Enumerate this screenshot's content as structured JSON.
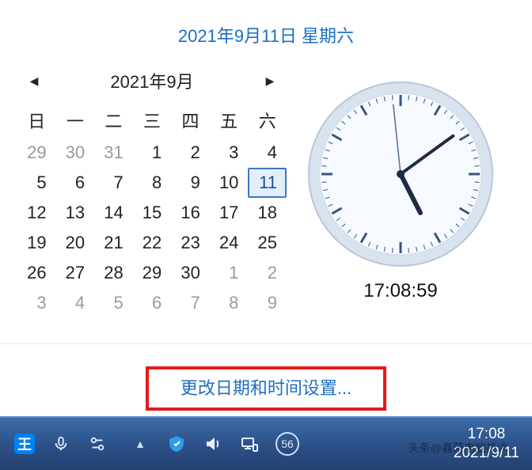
{
  "header": {
    "date_title": "2021年9月11日 星期六"
  },
  "calendar": {
    "month_label": "2021年9月",
    "weekdays": [
      "日",
      "一",
      "二",
      "三",
      "四",
      "五",
      "六"
    ],
    "days": [
      {
        "n": "29",
        "muted": true
      },
      {
        "n": "30",
        "muted": true
      },
      {
        "n": "31",
        "muted": true
      },
      {
        "n": "1"
      },
      {
        "n": "2"
      },
      {
        "n": "3"
      },
      {
        "n": "4"
      },
      {
        "n": "5"
      },
      {
        "n": "6"
      },
      {
        "n": "7"
      },
      {
        "n": "8"
      },
      {
        "n": "9"
      },
      {
        "n": "10"
      },
      {
        "n": "11",
        "today": true
      },
      {
        "n": "12"
      },
      {
        "n": "13"
      },
      {
        "n": "14"
      },
      {
        "n": "15"
      },
      {
        "n": "16"
      },
      {
        "n": "17"
      },
      {
        "n": "18"
      },
      {
        "n": "19"
      },
      {
        "n": "20"
      },
      {
        "n": "21"
      },
      {
        "n": "22"
      },
      {
        "n": "23"
      },
      {
        "n": "24"
      },
      {
        "n": "25"
      },
      {
        "n": "26"
      },
      {
        "n": "27"
      },
      {
        "n": "28"
      },
      {
        "n": "29"
      },
      {
        "n": "30"
      },
      {
        "n": "1",
        "muted": true
      },
      {
        "n": "2",
        "muted": true
      },
      {
        "n": "3",
        "muted": true
      },
      {
        "n": "4",
        "muted": true
      },
      {
        "n": "5",
        "muted": true
      },
      {
        "n": "6",
        "muted": true
      },
      {
        "n": "7",
        "muted": true
      },
      {
        "n": "8",
        "muted": true
      },
      {
        "n": "9",
        "muted": true
      }
    ]
  },
  "clock": {
    "digital": "17:08:59",
    "hour_angle": 153,
    "minute_angle": 54,
    "second_angle": 354,
    "face_outer": "#d9e3ef",
    "face_inner": "#f6f9fd",
    "tick_color": "#36547d",
    "hand_color": "#1b2b43",
    "second_color": "#556b8c"
  },
  "footer": {
    "settings_link": "更改日期和时间设置..."
  },
  "taskbar": {
    "icons": {
      "ime": "王",
      "circ_value": "56"
    },
    "time": "17:08",
    "date": "2021/9/11"
  },
  "watermark": "头条@鑫荣电脑技术"
}
